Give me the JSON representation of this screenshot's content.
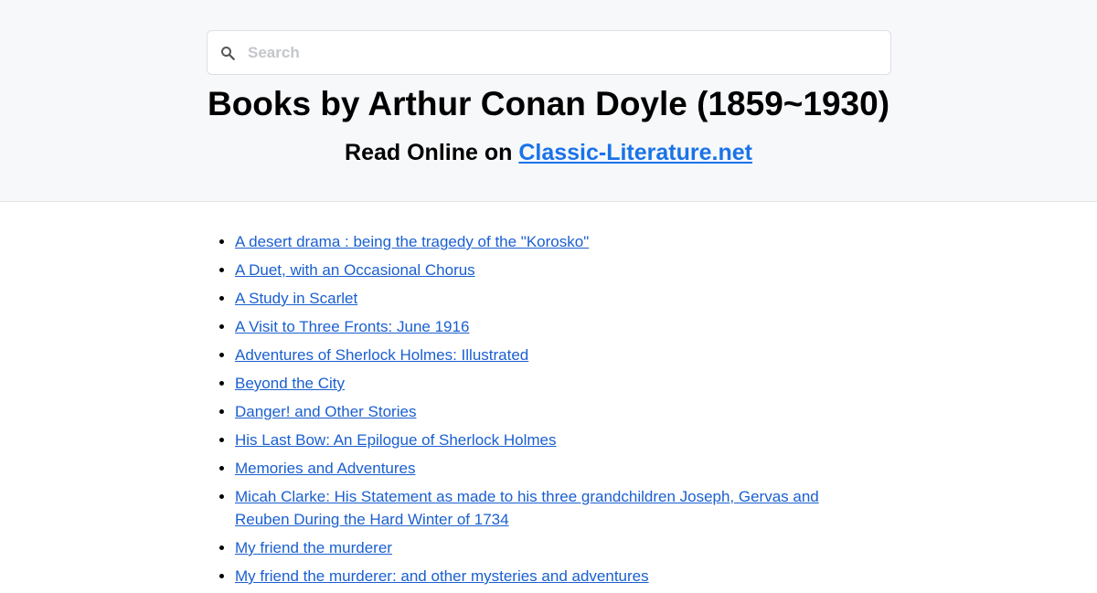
{
  "search": {
    "placeholder": "Search"
  },
  "header": {
    "title": "Books by Arthur Conan Doyle (1859~1930)",
    "subtitle_prefix": "Read Online on ",
    "subtitle_link": "Classic-Literature.net"
  },
  "books": [
    "A desert drama : being the tragedy of the \"Korosko\"",
    "A Duet, with an Occasional Chorus",
    "A Study in Scarlet",
    "A Visit to Three Fronts: June 1916",
    "Adventures of Sherlock Holmes: Illustrated",
    "Beyond the City",
    "Danger! and Other Stories",
    "His Last Bow: An Epilogue of Sherlock Holmes",
    "Memories and Adventures",
    "Micah Clarke: His Statement as made to his three grandchildren Joseph, Gervas and Reuben During the Hard Winter of 1734",
    "My friend the murderer",
    "My friend the murderer: and other mysteries and adventures"
  ],
  "colors": {
    "link": "#1a5fd0",
    "accent_link": "#1a73e8",
    "header_bg": "#f7f8fa"
  },
  "icons": {
    "search": "search-icon"
  }
}
